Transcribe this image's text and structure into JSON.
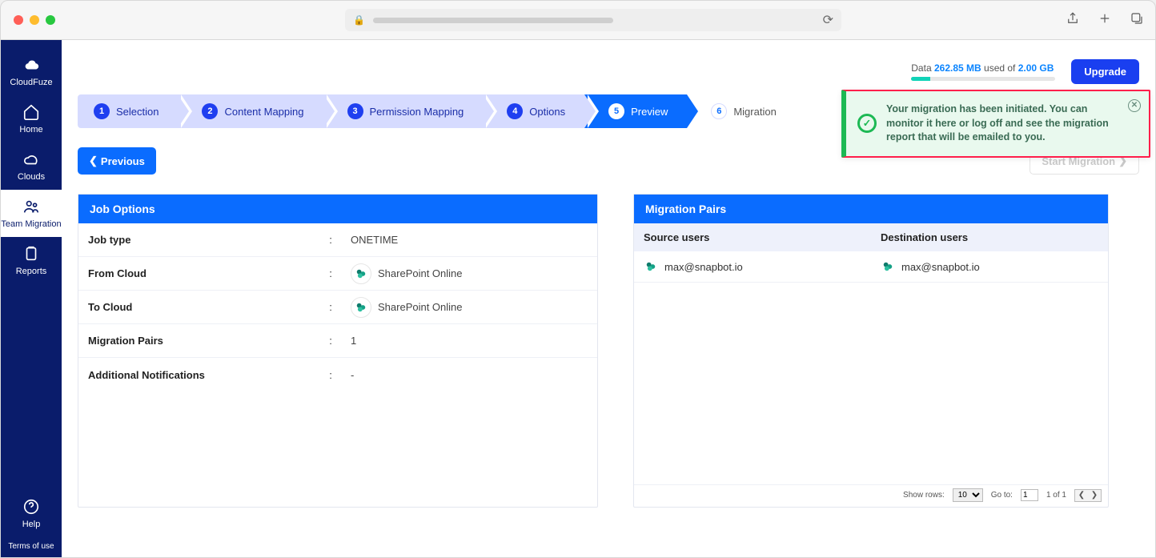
{
  "sidebar": {
    "brand": "CloudFuze",
    "items": [
      {
        "label": "Home"
      },
      {
        "label": "Clouds"
      },
      {
        "label": "Team Migration"
      },
      {
        "label": "Reports"
      }
    ],
    "help": "Help",
    "terms": "Terms of use"
  },
  "usage": {
    "prefix": "Data",
    "used": "262.85 MB",
    "middle": "used of",
    "total": "2.00 GB"
  },
  "upgrade_label": "Upgrade",
  "steps": [
    {
      "num": "1",
      "label": "Selection"
    },
    {
      "num": "2",
      "label": "Content Mapping"
    },
    {
      "num": "3",
      "label": "Permission Mapping"
    },
    {
      "num": "4",
      "label": "Options"
    },
    {
      "num": "5",
      "label": "Preview"
    },
    {
      "num": "6",
      "label": "Migration"
    }
  ],
  "buttons": {
    "previous": "Previous",
    "start": "Start Migration"
  },
  "job_options": {
    "title": "Job Options",
    "rows": {
      "job_type": {
        "label": "Job type",
        "value": "ONETIME"
      },
      "from_cloud": {
        "label": "From Cloud",
        "value": "SharePoint Online"
      },
      "to_cloud": {
        "label": "To Cloud",
        "value": "SharePoint Online"
      },
      "pairs": {
        "label": "Migration Pairs",
        "value": "1"
      },
      "notifications": {
        "label": "Additional Notifications",
        "value": "-"
      }
    }
  },
  "migration_pairs": {
    "title": "Migration Pairs",
    "headers": {
      "source": "Source users",
      "dest": "Destination users"
    },
    "rows": [
      {
        "source": "max@snapbot.io",
        "dest": "max@snapbot.io"
      }
    ],
    "footer": {
      "show_rows": "Show rows:",
      "rows_value": "10",
      "goto": "Go to:",
      "goto_value": "1",
      "page_info": "1 of 1"
    }
  },
  "toast": {
    "message": "Your migration has been initiated. You can monitor it here or log off and see the migration report that will be emailed to you."
  }
}
